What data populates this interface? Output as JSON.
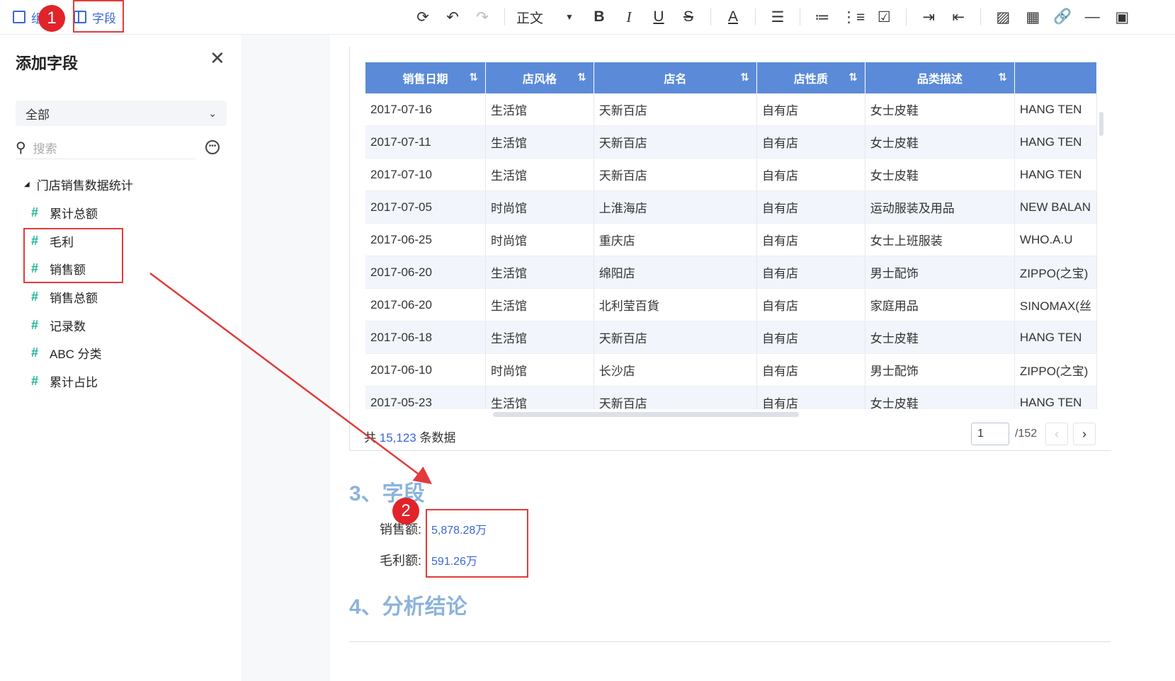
{
  "toolbar": {
    "left_items": [
      {
        "label": "组件",
        "icon": "component-icon"
      },
      {
        "label": "字段",
        "icon": "field-icon"
      }
    ],
    "style_select": "正文",
    "tools": [
      "refresh-icon",
      "undo-icon",
      "redo-icon",
      "style-select",
      "bold-icon",
      "italic-icon",
      "underline-icon",
      "strikethrough-icon",
      "font-color-icon",
      "align-icon",
      "bullet-list-icon",
      "numbered-list-icon",
      "checklist-icon",
      "indent-icon",
      "outdent-icon",
      "image-icon",
      "table-icon",
      "link-icon",
      "divider-icon",
      "panel-icon"
    ]
  },
  "sidebar": {
    "title": "添加字段",
    "filter_value": "全部",
    "search_placeholder": "搜索",
    "group": "门店销售数据统计",
    "fields": [
      {
        "label": "累计总额",
        "icon": "measure-icon"
      },
      {
        "label": "毛利",
        "icon": "measure-icon"
      },
      {
        "label": "销售额",
        "icon": "measure-icon"
      },
      {
        "label": "销售总额",
        "icon": "measure-icon"
      },
      {
        "label": "记录数",
        "icon": "measure-calc-icon"
      },
      {
        "label": "ABC 分类",
        "icon": "calc-field-icon"
      },
      {
        "label": "累计占比",
        "icon": "calc-field-icon"
      }
    ]
  },
  "table": {
    "columns": [
      "销售日期",
      "店风格",
      "店名",
      "店性质",
      "品类描述",
      ""
    ],
    "rows": [
      [
        "2017-07-16",
        "生活馆",
        "天新百店",
        "自有店",
        "女士皮鞋",
        "HANG TEN"
      ],
      [
        "2017-07-11",
        "生活馆",
        "天新百店",
        "自有店",
        "女士皮鞋",
        "HANG TEN"
      ],
      [
        "2017-07-10",
        "生活馆",
        "天新百店",
        "自有店",
        "女士皮鞋",
        "HANG TEN"
      ],
      [
        "2017-07-05",
        "时尚馆",
        "上淮海店",
        "自有店",
        "运动服装及用品",
        "NEW BALAN"
      ],
      [
        "2017-06-25",
        "时尚馆",
        "重庆店",
        "自有店",
        "女士上班服装",
        "WHO.A.U"
      ],
      [
        "2017-06-20",
        "生活馆",
        "绵阳店",
        "自有店",
        "男士配饰",
        "ZIPPO(之宝)"
      ],
      [
        "2017-06-20",
        "生活馆",
        "北利莹百貨",
        "自有店",
        "家庭用品",
        "SINOMAX(丝"
      ],
      [
        "2017-06-18",
        "生活馆",
        "天新百店",
        "自有店",
        "女士皮鞋",
        "HANG TEN"
      ],
      [
        "2017-06-10",
        "时尚馆",
        "长沙店",
        "自有店",
        "男士配饰",
        "ZIPPO(之宝)"
      ],
      [
        "2017-05-23",
        "生活馆",
        "天新百店",
        "自有店",
        "女士皮鞋",
        "HANG TEN"
      ]
    ],
    "total_prefix": "共",
    "total_count": "15,123",
    "total_suffix": "条数据",
    "page_current": "1",
    "page_total": "/152"
  },
  "document": {
    "section3_title": "3、字段",
    "sales_label": "销售额:",
    "sales_value": "5,878.28万",
    "profit_label": "毛利额:",
    "profit_value": "591.26万",
    "section4_title": "4、分析结论"
  },
  "annotations": {
    "badge1": "1",
    "badge2": "2",
    "highlight_color": "#e23b3b"
  }
}
